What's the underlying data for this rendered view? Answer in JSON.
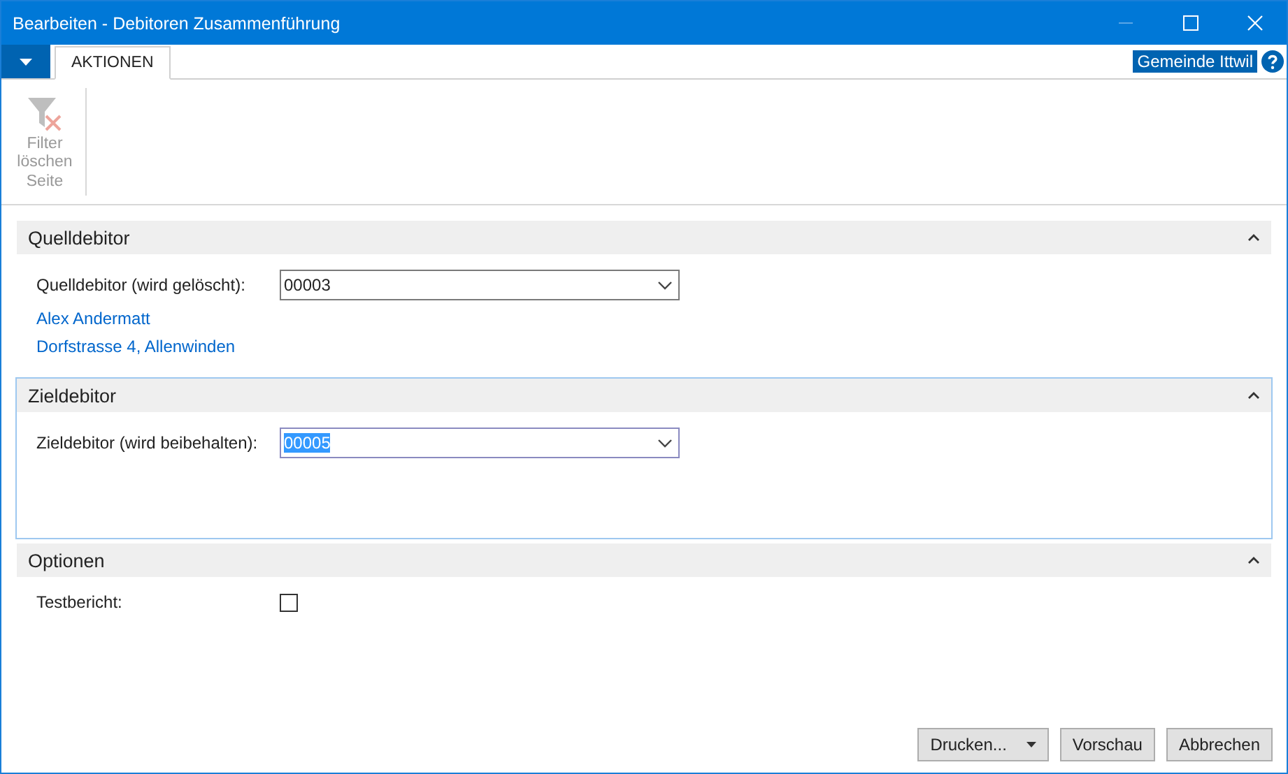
{
  "window": {
    "title": "Bearbeiten - Debitoren Zusammenführung"
  },
  "ribbon": {
    "tabs": [
      {
        "label": "AKTIONEN",
        "selected": true
      }
    ],
    "company": "Gemeinde Ittwil",
    "actions": [
      {
        "label": "Filter löschen",
        "disabled": true
      }
    ],
    "group": "Seite"
  },
  "sections": [
    {
      "title": "Quelldebitor",
      "expanded": true,
      "focused": false,
      "fields": [
        {
          "kind": "dropdown",
          "label": "Quelldebitor (wird gelöscht):",
          "value": "00003",
          "focused": false,
          "text_selected": false
        }
      ],
      "details": [
        "Alex Andermatt",
        "Dorfstrasse 4, Allenwinden"
      ]
    },
    {
      "title": "Zieldebitor",
      "expanded": true,
      "focused": true,
      "fields": [
        {
          "kind": "dropdown",
          "label": "Zieldebitor (wird beibehalten):",
          "value": "00005",
          "focused": true,
          "text_selected": true
        }
      ]
    },
    {
      "title": "Optionen",
      "expanded": true,
      "focused": false,
      "fields": [
        {
          "kind": "checkbox",
          "label": "Testbericht:",
          "checked": false
        }
      ]
    }
  ],
  "buttons": [
    {
      "label": "Drucken...",
      "has_menu": true
    },
    {
      "label": "Vorschau",
      "has_menu": false
    },
    {
      "label": "Abbrechen",
      "has_menu": false
    }
  ]
}
